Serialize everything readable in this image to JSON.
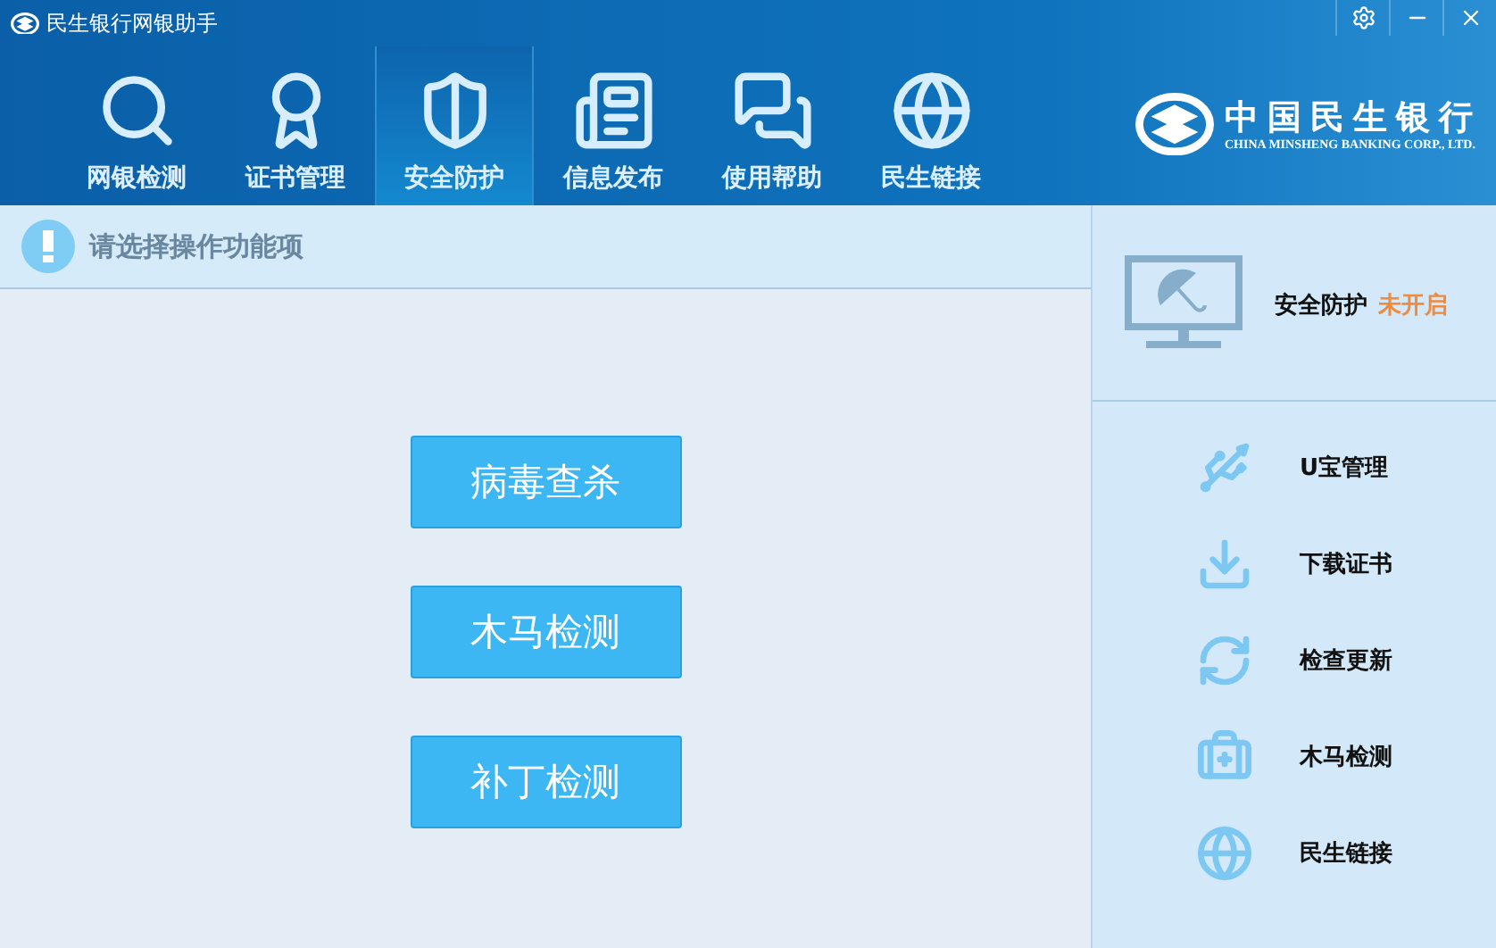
{
  "window": {
    "title": "民生银行网银助手"
  },
  "tabs": [
    {
      "label": "网银检测",
      "selected": false
    },
    {
      "label": "证书管理",
      "selected": false
    },
    {
      "label": "安全防护",
      "selected": true
    },
    {
      "label": "信息发布",
      "selected": false
    },
    {
      "label": "使用帮助",
      "selected": false
    },
    {
      "label": "民生链接",
      "selected": false
    }
  ],
  "logo": {
    "name": "中国民生银行",
    "english": "CHINA MINSHENG BANKING CORP., LTD."
  },
  "notice": "请选择操作功能项",
  "actions": [
    "病毒查杀",
    "木马检测",
    "补丁检测"
  ],
  "protection": {
    "label": "安全防护",
    "status": "未开启"
  },
  "side_links": [
    "U宝管理",
    "下载证书",
    "检查更新",
    "木马检测",
    "民生链接"
  ]
}
